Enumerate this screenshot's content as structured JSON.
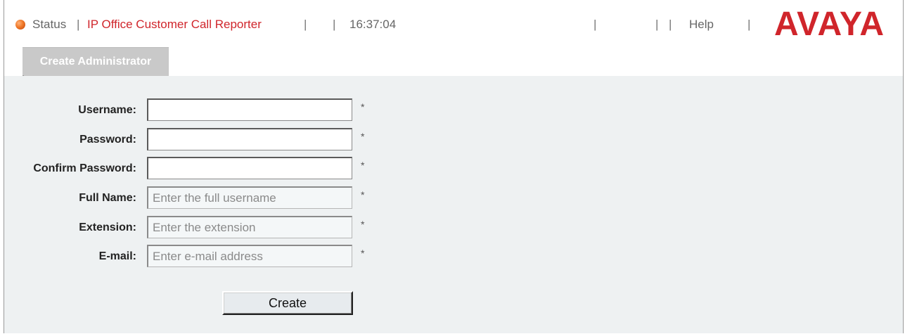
{
  "header": {
    "status_label": "Status",
    "app_title": "IP Office Customer Call Reporter",
    "time": "16:37:04",
    "help_label": "Help",
    "separator": "|",
    "logo_text": "AVAYA",
    "brand_color": "#d0252b"
  },
  "tabs": [
    {
      "label": "Create Administrator",
      "active": true
    }
  ],
  "form": {
    "username": {
      "label": "Username:",
      "value": "",
      "placeholder": "",
      "required": "*"
    },
    "password": {
      "label": "Password:",
      "value": "",
      "placeholder": "",
      "required": "*"
    },
    "confirm_password": {
      "label": "Confirm Password:",
      "value": "",
      "placeholder": "",
      "required": "*"
    },
    "full_name": {
      "label": "Full Name:",
      "value": "",
      "placeholder": "Enter the full username",
      "required": "*"
    },
    "extension": {
      "label": "Extension:",
      "value": "",
      "placeholder": "Enter the extension",
      "required": "*"
    },
    "email": {
      "label": "E-mail:",
      "value": "",
      "placeholder": "Enter e-mail address",
      "required": "*"
    },
    "submit_label": "Create"
  }
}
